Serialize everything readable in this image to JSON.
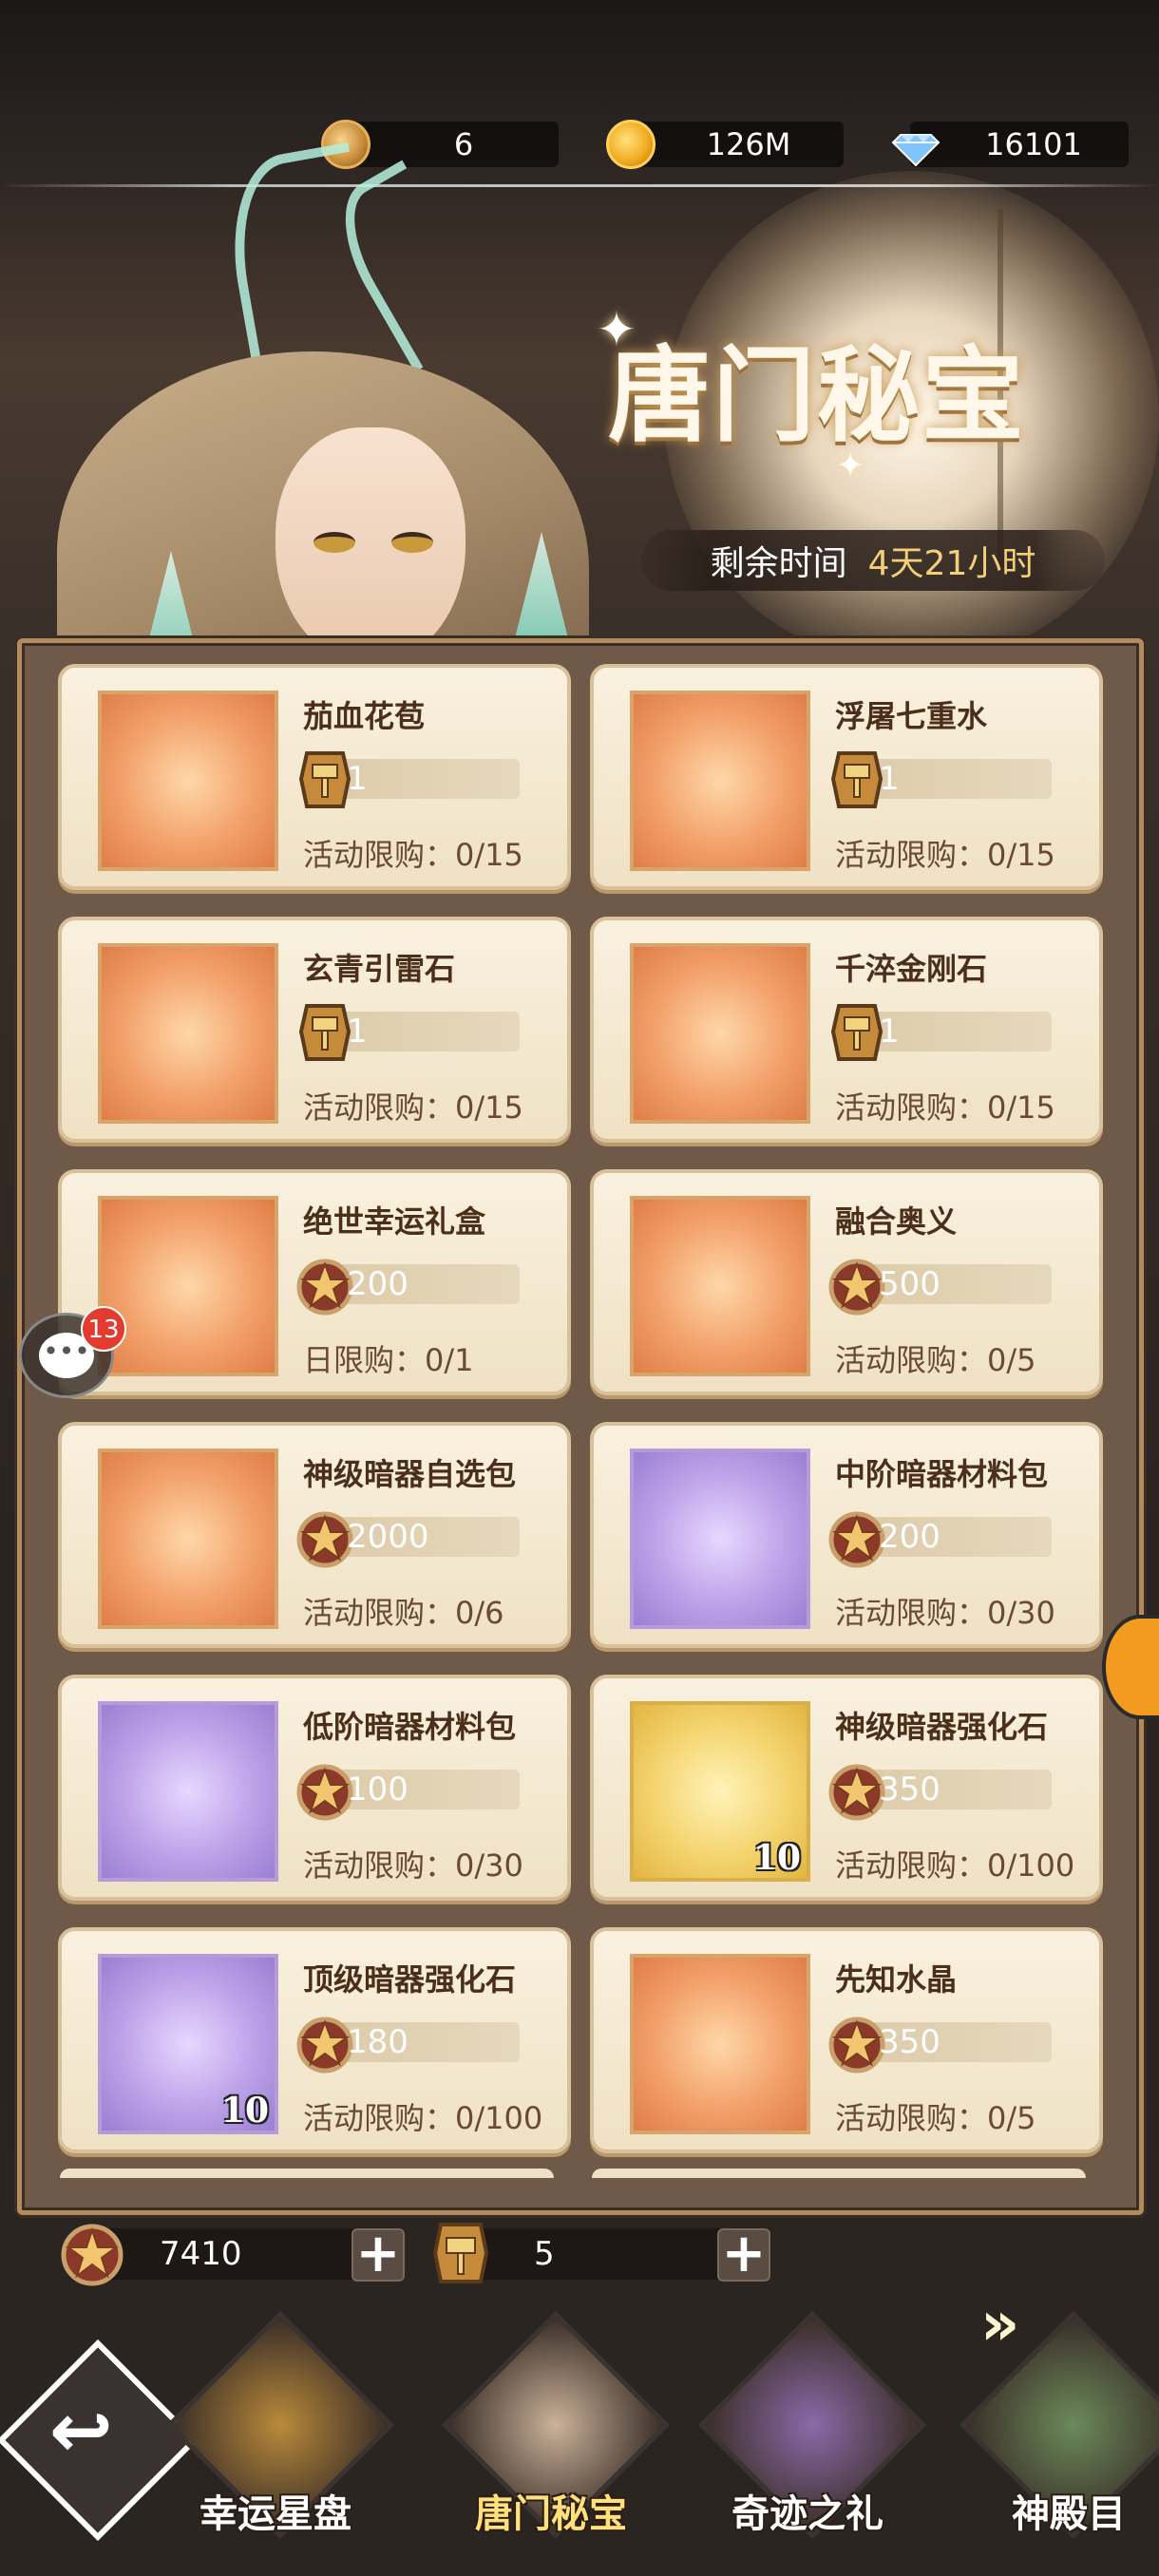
{
  "currency": {
    "medal": "6",
    "gold": "126M",
    "diamond": "16101"
  },
  "event": {
    "title": "唐门秘宝",
    "remaining_label": "剩余时间",
    "remaining_value": "4天21小时"
  },
  "items": [
    {
      "name": "茄血花苞",
      "currency": "hammer-token",
      "price": "1",
      "limit": "活动限购：0/15",
      "bg": "orange",
      "badge": ""
    },
    {
      "name": "浮屠七重水",
      "currency": "hammer-token",
      "price": "1",
      "limit": "活动限购：0/15",
      "bg": "orange",
      "badge": ""
    },
    {
      "name": "玄青引雷石",
      "currency": "hammer-token",
      "price": "1",
      "limit": "活动限购：0/15",
      "bg": "orange",
      "badge": ""
    },
    {
      "name": "千淬金刚石",
      "currency": "hammer-token",
      "price": "1",
      "limit": "活动限购：0/15",
      "bg": "orange",
      "badge": ""
    },
    {
      "name": "绝世幸运礼盒",
      "currency": "star-medal",
      "price": "200",
      "limit": "日限购：0/1",
      "bg": "orange",
      "badge": ""
    },
    {
      "name": "融合奥义",
      "currency": "star-medal",
      "price": "500",
      "limit": "活动限购：0/5",
      "bg": "orange",
      "badge": ""
    },
    {
      "name": "神级暗器自选包",
      "currency": "star-medal",
      "price": "2000",
      "limit": "活动限购：0/6",
      "bg": "orange",
      "badge": ""
    },
    {
      "name": "中阶暗器材料包",
      "currency": "star-medal",
      "price": "200",
      "limit": "活动限购：0/30",
      "bg": "purple",
      "badge": ""
    },
    {
      "name": "低阶暗器材料包",
      "currency": "star-medal",
      "price": "100",
      "limit": "活动限购：0/30",
      "bg": "purple",
      "badge": ""
    },
    {
      "name": "神级暗器强化石",
      "currency": "star-medal",
      "price": "350",
      "limit": "活动限购：0/100",
      "bg": "yellow",
      "badge": "10"
    },
    {
      "name": "顶级暗器强化石",
      "currency": "star-medal",
      "price": "180",
      "limit": "活动限购：0/100",
      "bg": "purple",
      "badge": "10"
    },
    {
      "name": "先知水晶",
      "currency": "star-medal",
      "price": "350",
      "limit": "活动限购：0/5",
      "bg": "orange",
      "badge": ""
    }
  ],
  "wallet": {
    "star_medal": "7410",
    "hammer_token": "5"
  },
  "chat_badge": "13",
  "nav": [
    {
      "label": "幸运星盘",
      "active": false
    },
    {
      "label": "唐门秘宝",
      "active": true
    },
    {
      "label": "奇迹之礼",
      "active": false
    },
    {
      "label": "神殿目",
      "active": false
    }
  ],
  "colors": {
    "accent_gold": "#f3cf7a",
    "card_bg": "#f9f1df",
    "badge_red": "#e23b2f"
  }
}
